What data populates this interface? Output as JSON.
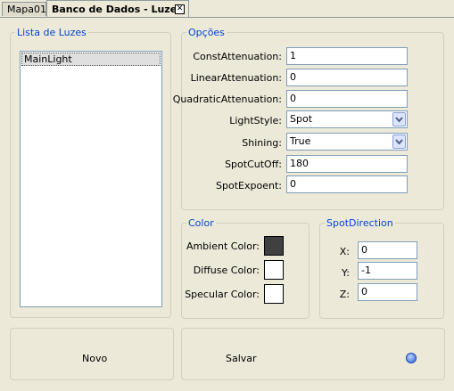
{
  "tabs": [
    {
      "label": "Mapa01"
    },
    {
      "label": "Banco de Dados - Luzes",
      "close": "✕"
    }
  ],
  "lights_group": {
    "title": "Lista de Luzes",
    "items": [
      "MainLight"
    ]
  },
  "options_group": {
    "title": "Opções",
    "fields": {
      "const_attenuation": {
        "label": "ConstAttenuation:",
        "value": "1"
      },
      "linear_attenuation": {
        "label": "LinearAttenuation:",
        "value": "0"
      },
      "quadratic_attenuation": {
        "label": "QuadraticAttenuation:",
        "value": "0"
      },
      "light_style": {
        "label": "LightStyle:",
        "value": "Spot"
      },
      "shining": {
        "label": "Shining:",
        "value": "True"
      },
      "spot_cutoff": {
        "label": "SpotCutOff:",
        "value": "180"
      },
      "spot_exponent": {
        "label": "SpotExpoent:",
        "value": "0"
      }
    }
  },
  "color_group": {
    "title": "Color",
    "ambient": {
      "label": "Ambient Color:",
      "color": "#404040"
    },
    "diffuse": {
      "label": "Diffuse Color:",
      "color": "#ffffff"
    },
    "specular": {
      "label": "Specular Color:",
      "color": "#ffffff"
    }
  },
  "spot_direction_group": {
    "title": "SpotDirection",
    "x": {
      "label": "X:",
      "value": "0"
    },
    "y": {
      "label": "Y:",
      "value": "-1"
    },
    "z": {
      "label": "Z:",
      "value": "0"
    }
  },
  "actions": {
    "new_label": "Novo",
    "save_label": "Salvar",
    "help_icon": "help-icon"
  }
}
